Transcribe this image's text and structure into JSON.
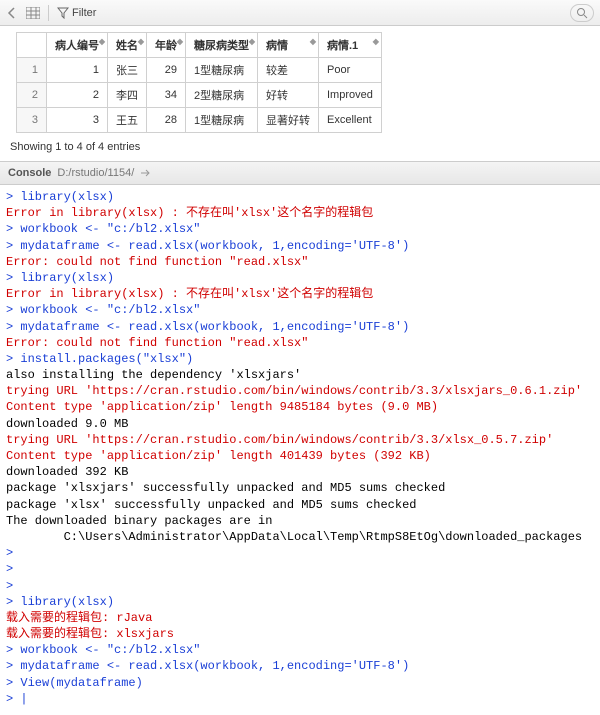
{
  "toolbar": {
    "filter_label": "Filter"
  },
  "table": {
    "headers": [
      "病人编号",
      "姓名",
      "年龄",
      "糖尿病类型",
      "病情",
      "病情.1"
    ],
    "rows": [
      {
        "n": "1",
        "id": "1",
        "name": "张三",
        "age": "29",
        "type": "1型糖尿病",
        "cond": "较差",
        "cond1": "Poor"
      },
      {
        "n": "2",
        "id": "2",
        "name": "李四",
        "age": "34",
        "type": "2型糖尿病",
        "cond": "好转",
        "cond1": "Improved"
      },
      {
        "n": "3",
        "id": "3",
        "name": "王五",
        "age": "28",
        "type": "1型糖尿病",
        "cond": "显著好转",
        "cond1": "Excellent"
      }
    ],
    "entries_text": "Showing 1 to 4 of 4 entries"
  },
  "console_header": {
    "tab": "Console",
    "path": "D:/rstudio/1154/"
  },
  "console_lines": [
    {
      "c": "blue",
      "t": "> library(xlsx)"
    },
    {
      "c": "red",
      "t": "Error in library(xlsx) : 不存在叫'xlsx'这个名字的程辑包"
    },
    {
      "c": "blue",
      "t": "> workbook <- \"c:/bl2.xlsx\""
    },
    {
      "c": "blue",
      "t": "> mydataframe <- read.xlsx(workbook, 1,encoding='UTF-8')"
    },
    {
      "c": "red",
      "t": "Error: could not find function \"read.xlsx\""
    },
    {
      "c": "blue",
      "t": "> library(xlsx)"
    },
    {
      "c": "red",
      "t": "Error in library(xlsx) : 不存在叫'xlsx'这个名字的程辑包"
    },
    {
      "c": "blue",
      "t": "> workbook <- \"c:/bl2.xlsx\""
    },
    {
      "c": "blue",
      "t": "> mydataframe <- read.xlsx(workbook, 1,encoding='UTF-8')"
    },
    {
      "c": "red",
      "t": "Error: could not find function \"read.xlsx\""
    },
    {
      "c": "blue",
      "t": "> install.packages(\"xlsx\")"
    },
    {
      "c": "black",
      "t": "also installing the dependency 'xlsxjars'"
    },
    {
      "c": "black",
      "t": ""
    },
    {
      "c": "red",
      "t": "trying URL 'https://cran.rstudio.com/bin/windows/contrib/3.3/xlsxjars_0.6.1.zip'"
    },
    {
      "c": "red",
      "t": "Content type 'application/zip' length 9485184 bytes (9.0 MB)"
    },
    {
      "c": "black",
      "t": "downloaded 9.0 MB"
    },
    {
      "c": "black",
      "t": ""
    },
    {
      "c": "red",
      "t": "trying URL 'https://cran.rstudio.com/bin/windows/contrib/3.3/xlsx_0.5.7.zip'"
    },
    {
      "c": "red",
      "t": "Content type 'application/zip' length 401439 bytes (392 KB)"
    },
    {
      "c": "black",
      "t": "downloaded 392 KB"
    },
    {
      "c": "black",
      "t": ""
    },
    {
      "c": "black",
      "t": "package 'xlsxjars' successfully unpacked and MD5 sums checked"
    },
    {
      "c": "black",
      "t": "package 'xlsx' successfully unpacked and MD5 sums checked"
    },
    {
      "c": "black",
      "t": ""
    },
    {
      "c": "black",
      "t": "The downloaded binary packages are in"
    },
    {
      "c": "black",
      "t": "        C:\\Users\\Administrator\\AppData\\Local\\Temp\\RtmpS8EtOg\\downloaded_packages"
    },
    {
      "c": "blue",
      "t": "> "
    },
    {
      "c": "blue",
      "t": "> "
    },
    {
      "c": "blue",
      "t": "> "
    },
    {
      "c": "blue",
      "t": "> library(xlsx)"
    },
    {
      "c": "red",
      "t": "载入需要的程辑包: rJava"
    },
    {
      "c": "red",
      "t": "载入需要的程辑包: xlsxjars"
    },
    {
      "c": "blue",
      "t": "> workbook <- \"c:/bl2.xlsx\""
    },
    {
      "c": "blue",
      "t": "> mydataframe <- read.xlsx(workbook, 1,encoding='UTF-8')"
    },
    {
      "c": "blue",
      "t": "> View(mydataframe)"
    },
    {
      "c": "blue",
      "t": "> |"
    }
  ]
}
